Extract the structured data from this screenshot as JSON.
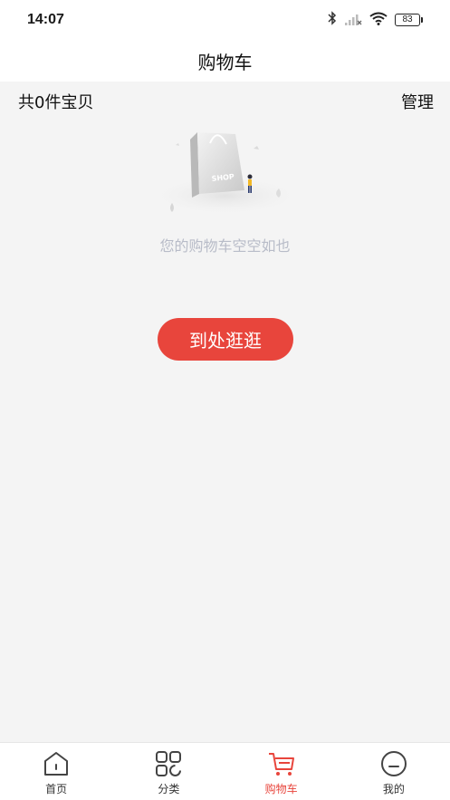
{
  "status_bar": {
    "time": "14:07",
    "battery": "83"
  },
  "header": {
    "title": "购物车"
  },
  "summary": {
    "count_text": "共0件宝贝",
    "manage_label": "管理"
  },
  "empty_state": {
    "illustration_text": "SHOP",
    "message": "您的购物车空空如也",
    "browse_button_label": "到处逛逛"
  },
  "tab_bar": {
    "items": [
      {
        "label": "首页",
        "icon": "home-icon",
        "active": false
      },
      {
        "label": "分类",
        "icon": "category-grid-icon",
        "active": false
      },
      {
        "label": "购物车",
        "icon": "cart-icon",
        "active": true
      },
      {
        "label": "我的",
        "icon": "profile-icon",
        "active": false
      }
    ]
  },
  "colors": {
    "accent": "#e8453c",
    "background": "#f4f4f4",
    "muted_text": "#b8bcc8"
  }
}
